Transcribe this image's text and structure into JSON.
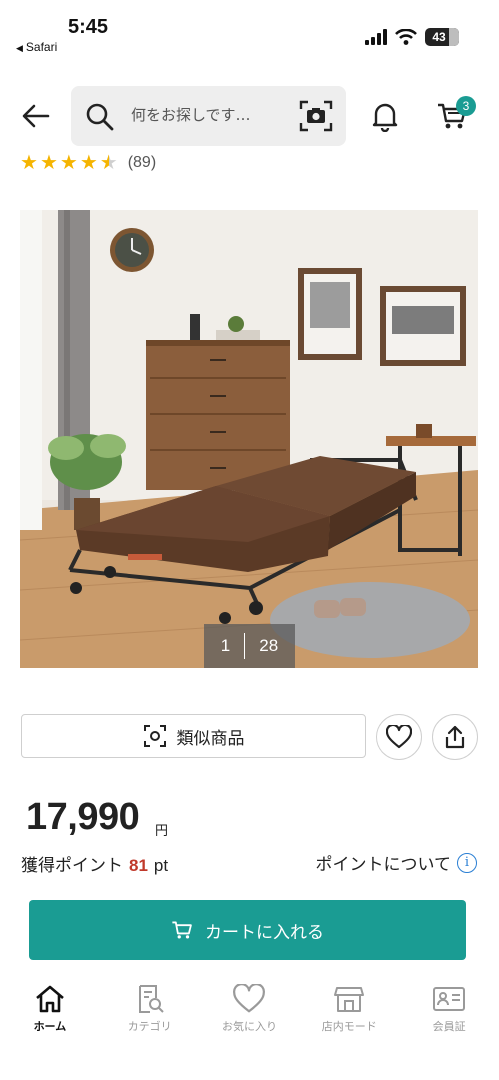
{
  "status_bar": {
    "time": "5:45",
    "back_app": "Safari",
    "battery": "43"
  },
  "header": {
    "search_placeholder": "何をお探しです…",
    "cart_count": "3"
  },
  "rating": {
    "stars": 4.5,
    "count": "(89)"
  },
  "product_image": {
    "current": "1",
    "total": "28"
  },
  "actions": {
    "similar_label": "類似商品"
  },
  "price": {
    "amount": "17,990",
    "unit": "円"
  },
  "points": {
    "label": "獲得ポイント",
    "value": "81",
    "unit": "pt",
    "about_label": "ポイントについて"
  },
  "add_to_cart": {
    "label": "カートに入れる"
  },
  "bottom_nav": {
    "items": [
      {
        "label": "ホーム",
        "icon": "home-icon",
        "active": true
      },
      {
        "label": "カテゴリ",
        "icon": "category-search-icon",
        "active": false
      },
      {
        "label": "お気に入り",
        "icon": "heart-icon",
        "active": false
      },
      {
        "label": "店内モード",
        "icon": "store-icon",
        "active": false
      },
      {
        "label": "会員証",
        "icon": "member-card-icon",
        "active": false
      }
    ]
  },
  "colors": {
    "accent": "#1a9c93",
    "points_value": "#c0392b",
    "info": "#2a7fd4",
    "star": "#f5b400"
  }
}
